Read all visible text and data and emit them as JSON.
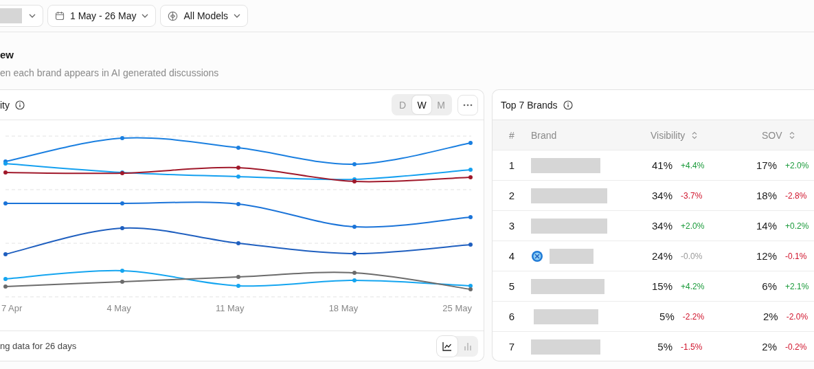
{
  "filters": [
    {
      "kind": "redacted"
    },
    {
      "kind": "date",
      "label": "1 May - 26 May"
    },
    {
      "kind": "model",
      "label": "All Models"
    }
  ],
  "section": {
    "title": "ew",
    "subtitle": "en each brand appears in AI generated discussions"
  },
  "chart_card": {
    "title": "ity",
    "periods": [
      {
        "label": "D",
        "selected": false
      },
      {
        "label": "W",
        "selected": true
      },
      {
        "label": "M",
        "selected": false
      }
    ],
    "x_labels": [
      "7 Apr",
      "4 May",
      "11 May",
      "18 May",
      "25 May"
    ],
    "footer": "ng data for 26 days",
    "views": [
      {
        "kind": "line",
        "selected": true
      },
      {
        "kind": "bar",
        "selected": false
      }
    ]
  },
  "brands_card": {
    "title": "Top 7 Brands",
    "columns": [
      {
        "label": "#",
        "sortable": false
      },
      {
        "label": "Brand",
        "sortable": false
      },
      {
        "label": "Visibility",
        "sortable": true
      },
      {
        "label": "SOV",
        "sortable": true
      }
    ],
    "rows": [
      {
        "rank": "1",
        "logo": false,
        "visibility": {
          "value": "41%",
          "change": "+4.4%",
          "color": "#1a9a3a"
        },
        "sov": {
          "value": "17%",
          "change": "+2.0%",
          "color": "#1a9a3a"
        }
      },
      {
        "rank": "2",
        "logo": false,
        "visibility": {
          "value": "34%",
          "change": "-3.7%",
          "color": "#d0142c"
        },
        "sov": {
          "value": "18%",
          "change": "-2.8%",
          "color": "#d0142c"
        }
      },
      {
        "rank": "3",
        "logo": false,
        "visibility": {
          "value": "34%",
          "change": "+2.0%",
          "color": "#1a9a3a"
        },
        "sov": {
          "value": "14%",
          "change": "+0.2%",
          "color": "#1a9a3a"
        }
      },
      {
        "rank": "4",
        "logo": true,
        "visibility": {
          "value": "24%",
          "change": "-0.0%",
          "color": "#999999"
        },
        "sov": {
          "value": "12%",
          "change": "-0.1%",
          "color": "#d0142c"
        }
      },
      {
        "rank": "5",
        "logo": false,
        "visibility": {
          "value": "15%",
          "change": "+4.2%",
          "color": "#1a9a3a"
        },
        "sov": {
          "value": "6%",
          "change": "+2.1%",
          "color": "#1a9a3a"
        }
      },
      {
        "rank": "6",
        "logo": false,
        "visibility": {
          "value": "5%",
          "change": "-2.2%",
          "color": "#d0142c"
        },
        "sov": {
          "value": "2%",
          "change": "-2.0%",
          "color": "#d0142c"
        }
      },
      {
        "rank": "7",
        "logo": false,
        "visibility": {
          "value": "5%",
          "change": "-1.5%",
          "color": "#d0142c"
        },
        "sov": {
          "value": "2%",
          "change": "-0.2%",
          "color": "#d0142c"
        }
      }
    ]
  }
}
